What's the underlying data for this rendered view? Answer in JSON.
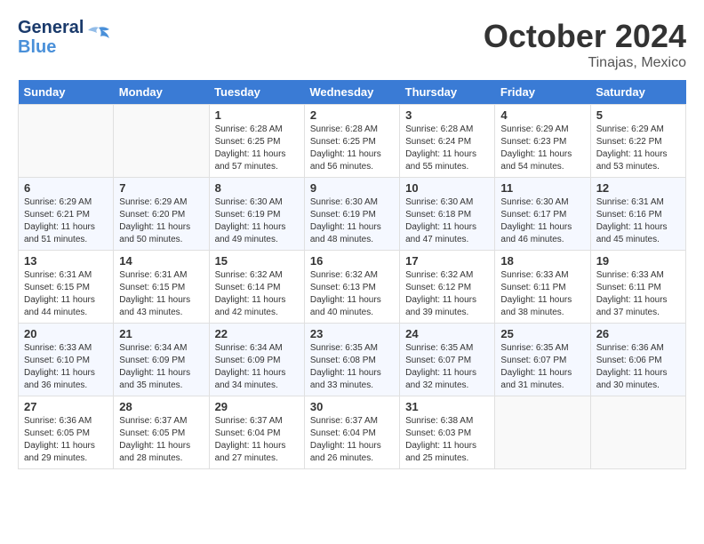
{
  "header": {
    "logo_general": "General",
    "logo_blue": "Blue",
    "month_title": "October 2024",
    "location": "Tinajas, Mexico"
  },
  "days_of_week": [
    "Sunday",
    "Monday",
    "Tuesday",
    "Wednesday",
    "Thursday",
    "Friday",
    "Saturday"
  ],
  "weeks": [
    [
      {
        "day": "",
        "sunrise": "",
        "sunset": "",
        "daylight": ""
      },
      {
        "day": "",
        "sunrise": "",
        "sunset": "",
        "daylight": ""
      },
      {
        "day": "1",
        "sunrise": "Sunrise: 6:28 AM",
        "sunset": "Sunset: 6:25 PM",
        "daylight": "Daylight: 11 hours and 57 minutes."
      },
      {
        "day": "2",
        "sunrise": "Sunrise: 6:28 AM",
        "sunset": "Sunset: 6:25 PM",
        "daylight": "Daylight: 11 hours and 56 minutes."
      },
      {
        "day": "3",
        "sunrise": "Sunrise: 6:28 AM",
        "sunset": "Sunset: 6:24 PM",
        "daylight": "Daylight: 11 hours and 55 minutes."
      },
      {
        "day": "4",
        "sunrise": "Sunrise: 6:29 AM",
        "sunset": "Sunset: 6:23 PM",
        "daylight": "Daylight: 11 hours and 54 minutes."
      },
      {
        "day": "5",
        "sunrise": "Sunrise: 6:29 AM",
        "sunset": "Sunset: 6:22 PM",
        "daylight": "Daylight: 11 hours and 53 minutes."
      }
    ],
    [
      {
        "day": "6",
        "sunrise": "Sunrise: 6:29 AM",
        "sunset": "Sunset: 6:21 PM",
        "daylight": "Daylight: 11 hours and 51 minutes."
      },
      {
        "day": "7",
        "sunrise": "Sunrise: 6:29 AM",
        "sunset": "Sunset: 6:20 PM",
        "daylight": "Daylight: 11 hours and 50 minutes."
      },
      {
        "day": "8",
        "sunrise": "Sunrise: 6:30 AM",
        "sunset": "Sunset: 6:19 PM",
        "daylight": "Daylight: 11 hours and 49 minutes."
      },
      {
        "day": "9",
        "sunrise": "Sunrise: 6:30 AM",
        "sunset": "Sunset: 6:19 PM",
        "daylight": "Daylight: 11 hours and 48 minutes."
      },
      {
        "day": "10",
        "sunrise": "Sunrise: 6:30 AM",
        "sunset": "Sunset: 6:18 PM",
        "daylight": "Daylight: 11 hours and 47 minutes."
      },
      {
        "day": "11",
        "sunrise": "Sunrise: 6:30 AM",
        "sunset": "Sunset: 6:17 PM",
        "daylight": "Daylight: 11 hours and 46 minutes."
      },
      {
        "day": "12",
        "sunrise": "Sunrise: 6:31 AM",
        "sunset": "Sunset: 6:16 PM",
        "daylight": "Daylight: 11 hours and 45 minutes."
      }
    ],
    [
      {
        "day": "13",
        "sunrise": "Sunrise: 6:31 AM",
        "sunset": "Sunset: 6:15 PM",
        "daylight": "Daylight: 11 hours and 44 minutes."
      },
      {
        "day": "14",
        "sunrise": "Sunrise: 6:31 AM",
        "sunset": "Sunset: 6:15 PM",
        "daylight": "Daylight: 11 hours and 43 minutes."
      },
      {
        "day": "15",
        "sunrise": "Sunrise: 6:32 AM",
        "sunset": "Sunset: 6:14 PM",
        "daylight": "Daylight: 11 hours and 42 minutes."
      },
      {
        "day": "16",
        "sunrise": "Sunrise: 6:32 AM",
        "sunset": "Sunset: 6:13 PM",
        "daylight": "Daylight: 11 hours and 40 minutes."
      },
      {
        "day": "17",
        "sunrise": "Sunrise: 6:32 AM",
        "sunset": "Sunset: 6:12 PM",
        "daylight": "Daylight: 11 hours and 39 minutes."
      },
      {
        "day": "18",
        "sunrise": "Sunrise: 6:33 AM",
        "sunset": "Sunset: 6:11 PM",
        "daylight": "Daylight: 11 hours and 38 minutes."
      },
      {
        "day": "19",
        "sunrise": "Sunrise: 6:33 AM",
        "sunset": "Sunset: 6:11 PM",
        "daylight": "Daylight: 11 hours and 37 minutes."
      }
    ],
    [
      {
        "day": "20",
        "sunrise": "Sunrise: 6:33 AM",
        "sunset": "Sunset: 6:10 PM",
        "daylight": "Daylight: 11 hours and 36 minutes."
      },
      {
        "day": "21",
        "sunrise": "Sunrise: 6:34 AM",
        "sunset": "Sunset: 6:09 PM",
        "daylight": "Daylight: 11 hours and 35 minutes."
      },
      {
        "day": "22",
        "sunrise": "Sunrise: 6:34 AM",
        "sunset": "Sunset: 6:09 PM",
        "daylight": "Daylight: 11 hours and 34 minutes."
      },
      {
        "day": "23",
        "sunrise": "Sunrise: 6:35 AM",
        "sunset": "Sunset: 6:08 PM",
        "daylight": "Daylight: 11 hours and 33 minutes."
      },
      {
        "day": "24",
        "sunrise": "Sunrise: 6:35 AM",
        "sunset": "Sunset: 6:07 PM",
        "daylight": "Daylight: 11 hours and 32 minutes."
      },
      {
        "day": "25",
        "sunrise": "Sunrise: 6:35 AM",
        "sunset": "Sunset: 6:07 PM",
        "daylight": "Daylight: 11 hours and 31 minutes."
      },
      {
        "day": "26",
        "sunrise": "Sunrise: 6:36 AM",
        "sunset": "Sunset: 6:06 PM",
        "daylight": "Daylight: 11 hours and 30 minutes."
      }
    ],
    [
      {
        "day": "27",
        "sunrise": "Sunrise: 6:36 AM",
        "sunset": "Sunset: 6:05 PM",
        "daylight": "Daylight: 11 hours and 29 minutes."
      },
      {
        "day": "28",
        "sunrise": "Sunrise: 6:37 AM",
        "sunset": "Sunset: 6:05 PM",
        "daylight": "Daylight: 11 hours and 28 minutes."
      },
      {
        "day": "29",
        "sunrise": "Sunrise: 6:37 AM",
        "sunset": "Sunset: 6:04 PM",
        "daylight": "Daylight: 11 hours and 27 minutes."
      },
      {
        "day": "30",
        "sunrise": "Sunrise: 6:37 AM",
        "sunset": "Sunset: 6:04 PM",
        "daylight": "Daylight: 11 hours and 26 minutes."
      },
      {
        "day": "31",
        "sunrise": "Sunrise: 6:38 AM",
        "sunset": "Sunset: 6:03 PM",
        "daylight": "Daylight: 11 hours and 25 minutes."
      },
      {
        "day": "",
        "sunrise": "",
        "sunset": "",
        "daylight": ""
      },
      {
        "day": "",
        "sunrise": "",
        "sunset": "",
        "daylight": ""
      }
    ]
  ]
}
